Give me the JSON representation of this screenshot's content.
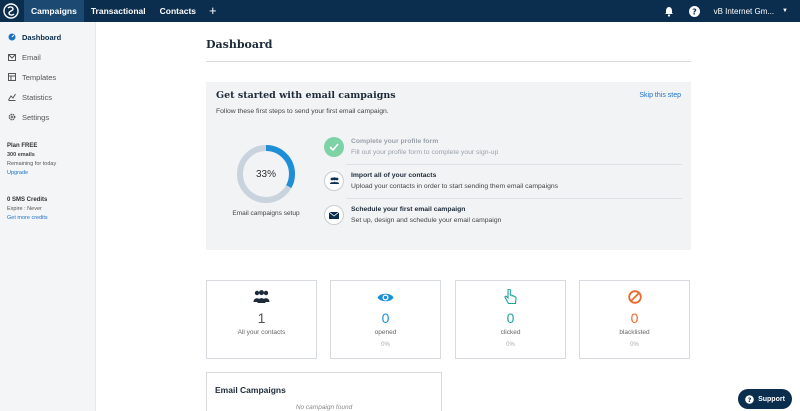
{
  "topbar": {
    "tabs": [
      {
        "label": "Campaigns"
      },
      {
        "label": "Transactional"
      },
      {
        "label": "Contacts"
      }
    ],
    "plus": "+",
    "account": "vB Internet Gm...",
    "icons": [
      "logo-icon",
      "bell-icon",
      "help-icon",
      "chevron-down-icon"
    ]
  },
  "sidebar": {
    "items": [
      {
        "label": "Dashboard",
        "icon": "dashboard-icon"
      },
      {
        "label": "Email",
        "icon": "email-icon"
      },
      {
        "label": "Templates",
        "icon": "templates-icon"
      },
      {
        "label": "Statistics",
        "icon": "statistics-icon"
      },
      {
        "label": "Settings",
        "icon": "gear-icon"
      }
    ],
    "plan": {
      "title": "Plan FREE",
      "emails": "300 emails",
      "remaining": "Remaining for today",
      "upgrade": "Upgrade"
    },
    "sms": {
      "title": "0 SMS Credits",
      "expire": "Expire : Never",
      "link": "Get more credits"
    }
  },
  "main": {
    "title": "Dashboard",
    "getstarted": {
      "title": "Get started with email campaigns",
      "subtitle": "Follow these first steps to send your first email campaign.",
      "skip": "Skip this step",
      "progress_value": 0.33,
      "progress_text": "33%",
      "progress_label": "Email campaigns setup",
      "steps": [
        {
          "title": "Complete your profile form",
          "desc": "Fill out your profile form to complete your sign-up",
          "done": true,
          "icon": "check-icon"
        },
        {
          "title": "Import all of your contacts",
          "desc": "Upload your contacts in order to start sending them email campaigns",
          "done": false,
          "icon": "contacts-icon"
        },
        {
          "title": "Schedule your first email campaign",
          "desc": "Set up, design and schedule your email campaign",
          "done": false,
          "icon": "envelope-icon"
        }
      ]
    },
    "stats": [
      {
        "value": "1",
        "label": "All your contacts",
        "pct": "",
        "icon": "people-icon"
      },
      {
        "value": "0",
        "label": "opened",
        "pct": "0%",
        "icon": "eye-icon"
      },
      {
        "value": "0",
        "label": "clicked",
        "pct": "0%",
        "icon": "pointer-icon"
      },
      {
        "value": "0",
        "label": "blacklisted",
        "pct": "0%",
        "icon": "blocked-icon"
      }
    ],
    "campaigns": {
      "title": "Email Campaigns",
      "empty": "No campaign found"
    }
  },
  "support": {
    "label": "Support",
    "icon": "chat-icon"
  },
  "colors": {
    "topbar": "#0b2d4e",
    "accent": "#1e8fd6",
    "teal": "#1ea39a",
    "orange": "#e86a2a",
    "success": "#7ed3a6"
  }
}
